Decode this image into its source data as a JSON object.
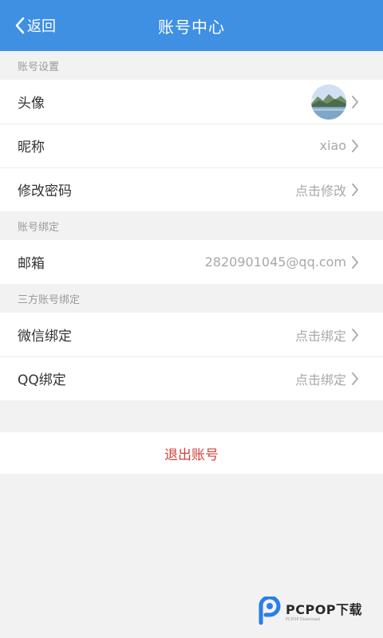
{
  "header": {
    "back_label": "返回",
    "title": "账号中心"
  },
  "sections": {
    "account_settings": "账号设置",
    "account_binding": "账号绑定",
    "third_party_binding": "三方账号绑定"
  },
  "rows": {
    "avatar": {
      "label": "头像"
    },
    "nickname": {
      "label": "昵称",
      "value": "xiao"
    },
    "password": {
      "label": "修改密码",
      "value": "点击修改"
    },
    "email": {
      "label": "邮箱",
      "value": "2820901045@qq.com"
    },
    "wechat": {
      "label": "微信绑定",
      "value": "点击绑定"
    },
    "qq": {
      "label": "QQ绑定",
      "value": "点击绑定"
    }
  },
  "logout_label": "退出账号",
  "watermark": {
    "main": "PCPOP下载",
    "sub": "PCPOP Download"
  },
  "colors": {
    "header": "#3f8fe3",
    "logout": "#d0433a",
    "watermark_brand": "#2b7de9"
  },
  "icons": {
    "back": "chevron-left-icon",
    "row_arrow": "chevron-right-icon",
    "watermark_logo": "pcpop-logo-icon"
  }
}
